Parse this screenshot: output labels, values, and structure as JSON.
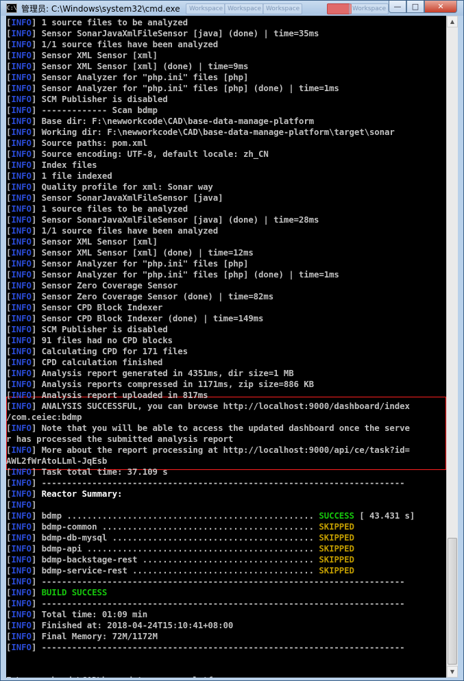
{
  "window": {
    "title": "管理员: C:\\Windows\\system32\\cmd.exe",
    "icon_text": "C:\\",
    "background_tabs": [
      "Workspace",
      "Workspace",
      "Workspace",
      "Workspace"
    ],
    "controls": {
      "minimize": "—",
      "maximize": "□",
      "close": "✕"
    }
  },
  "console": {
    "tag": "INFO",
    "lines": [
      {
        "t": "1 source files to be analyzed",
        "tag": true
      },
      {
        "t": "Sensor SonarJavaXmlFileSensor [java] (done) | time=35ms",
        "tag": true
      },
      {
        "t": "1/1 source files have been analyzed",
        "tag": true
      },
      {
        "t": "Sensor XML Sensor [xml]",
        "tag": true
      },
      {
        "t": "Sensor XML Sensor [xml] (done) | time=9ms",
        "tag": true
      },
      {
        "t": "Sensor Analyzer for \"php.ini\" files [php]",
        "tag": true
      },
      {
        "t": "Sensor Analyzer for \"php.ini\" files [php] (done) | time=1ms",
        "tag": true
      },
      {
        "t": "SCM Publisher is disabled",
        "tag": true
      },
      {
        "t": "------------- Scan bdmp",
        "tag": true
      },
      {
        "t": "Base dir: F:\\newworkcode\\CAD\\base-data-manage-platform",
        "tag": true
      },
      {
        "t": "Working dir: F:\\newworkcode\\CAD\\base-data-manage-platform\\target\\sonar",
        "tag": true
      },
      {
        "t": "Source paths: pom.xml",
        "tag": true
      },
      {
        "t": "Source encoding: UTF-8, default locale: zh_CN",
        "tag": true
      },
      {
        "t": "Index files",
        "tag": true
      },
      {
        "t": "1 file indexed",
        "tag": true
      },
      {
        "t": "Quality profile for xml: Sonar way",
        "tag": true
      },
      {
        "t": "Sensor SonarJavaXmlFileSensor [java]",
        "tag": true
      },
      {
        "t": "1 source files to be analyzed",
        "tag": true
      },
      {
        "t": "Sensor SonarJavaXmlFileSensor [java] (done) | time=28ms",
        "tag": true
      },
      {
        "t": "1/1 source files have been analyzed",
        "tag": true
      },
      {
        "t": "Sensor XML Sensor [xml]",
        "tag": true
      },
      {
        "t": "Sensor XML Sensor [xml] (done) | time=12ms",
        "tag": true
      },
      {
        "t": "Sensor Analyzer for \"php.ini\" files [php]",
        "tag": true
      },
      {
        "t": "Sensor Analyzer for \"php.ini\" files [php] (done) | time=1ms",
        "tag": true
      },
      {
        "t": "Sensor Zero Coverage Sensor",
        "tag": true
      },
      {
        "t": "Sensor Zero Coverage Sensor (done) | time=82ms",
        "tag": true
      },
      {
        "t": "Sensor CPD Block Indexer",
        "tag": true
      },
      {
        "t": "Sensor CPD Block Indexer (done) | time=149ms",
        "tag": true
      },
      {
        "t": "SCM Publisher is disabled",
        "tag": true
      },
      {
        "t": "91 files had no CPD blocks",
        "tag": true
      },
      {
        "t": "Calculating CPD for 171 files",
        "tag": true
      },
      {
        "t": "CPD calculation finished",
        "tag": true
      },
      {
        "t": "Analysis report generated in 4351ms, dir size=1 MB",
        "tag": true
      },
      {
        "t": "Analysis reports compressed in 1171ms, zip size=886 KB",
        "tag": true
      },
      {
        "t": "Analysis report uploaded in 817ms",
        "tag": true
      },
      {
        "t": "ANALYSIS SUCCESSFUL, you can browse http://localhost:9000/dashboard/index",
        "tag": true
      },
      {
        "t": "/com.ceiec:bdmp",
        "tag": false
      },
      {
        "t": "Note that you will be able to access the updated dashboard once the serve",
        "tag": true
      },
      {
        "t": "r has processed the submitted analysis report",
        "tag": false
      },
      {
        "t": "More about the report processing at http://localhost:9000/api/ce/task?id=",
        "tag": true
      },
      {
        "t": "AWL2fWrAtoLLml-JqEsb",
        "tag": false
      },
      {
        "t": "Task total time: 37.109 s",
        "tag": true
      },
      {
        "t": "------------------------------------------------------------------------",
        "tag": true
      },
      {
        "t": "Reactor Summary:",
        "tag": true,
        "cls": "white"
      },
      {
        "t": "",
        "tag": true
      },
      {
        "t": "bdmp ................................................. ",
        "tag": true,
        "status": "SUCCESS",
        "status_cls": "green",
        "extra": " [ 43.431 s]"
      },
      {
        "t": "bdmp-common .......................................... ",
        "tag": true,
        "status": "SKIPPED",
        "status_cls": "yellow"
      },
      {
        "t": "bdmp-db-mysql ........................................ ",
        "tag": true,
        "status": "SKIPPED",
        "status_cls": "yellow"
      },
      {
        "t": "bdmp-api ............................................. ",
        "tag": true,
        "status": "SKIPPED",
        "status_cls": "yellow"
      },
      {
        "t": "bdmp-backstage-rest .................................. ",
        "tag": true,
        "status": "SKIPPED",
        "status_cls": "yellow"
      },
      {
        "t": "bdmp-service-rest .................................... ",
        "tag": true,
        "status": "SKIPPED",
        "status_cls": "yellow"
      },
      {
        "t": "------------------------------------------------------------------------",
        "tag": true
      },
      {
        "t": "BUILD SUCCESS",
        "tag": true,
        "cls": "green"
      },
      {
        "t": "------------------------------------------------------------------------",
        "tag": true
      },
      {
        "t": "Total time: 01:09 min",
        "tag": true
      },
      {
        "t": "Finished at: 2018-04-24T15:10:41+08:00",
        "tag": true
      },
      {
        "t": "Final Memory: 72M/1172M",
        "tag": true
      },
      {
        "t": "------------------------------------------------------------------------",
        "tag": true
      },
      {
        "t": "",
        "tag": false
      },
      {
        "t": "",
        "tag": false
      },
      {
        "t": "F:\\newworkcode\\CAD\\base-data-manage-platform>",
        "tag": false,
        "prompt": true
      }
    ]
  }
}
